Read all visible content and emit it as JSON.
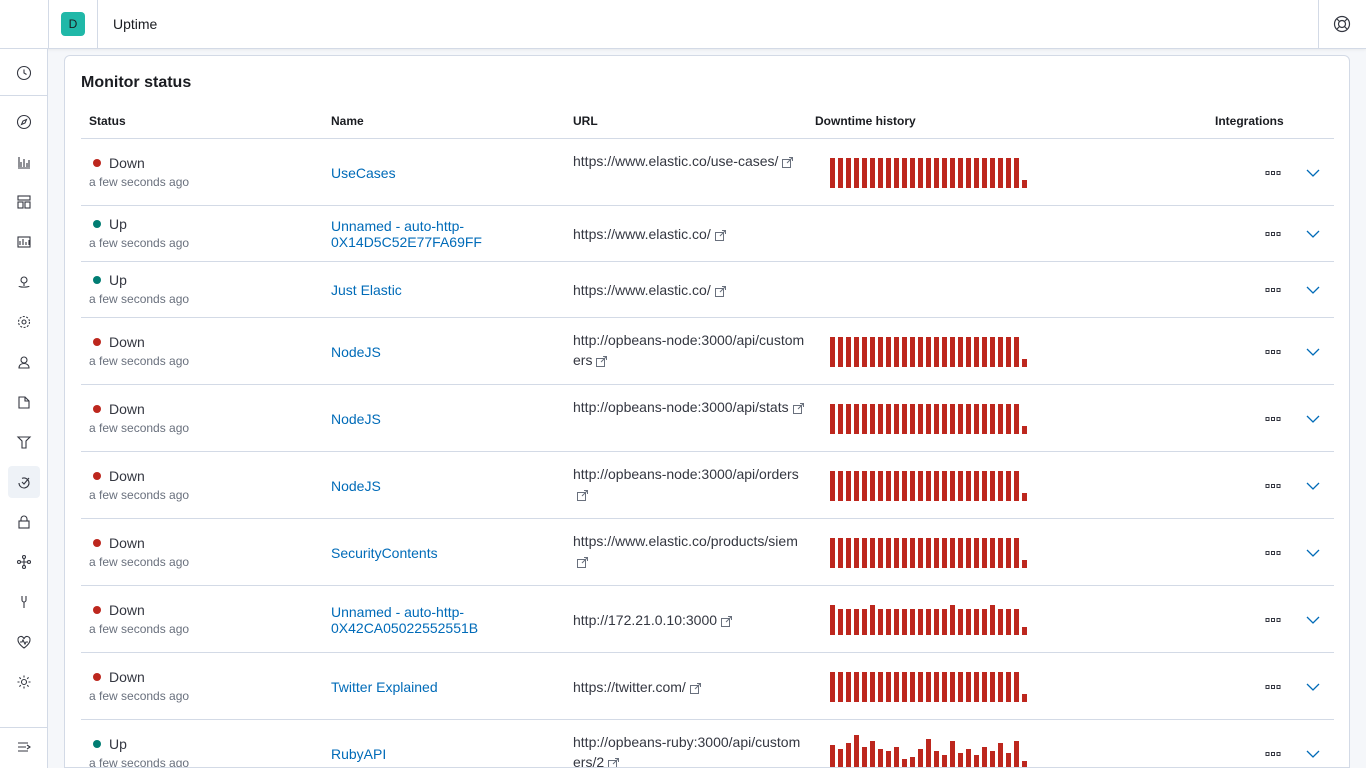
{
  "app": {
    "space_letter": "D",
    "title": "Uptime"
  },
  "sidebar": {
    "items": [
      {
        "icon": "clock-icon"
      },
      {
        "icon": "compass-icon"
      },
      {
        "icon": "chart-icon"
      },
      {
        "icon": "dashboard-icon"
      },
      {
        "icon": "canvas-icon"
      },
      {
        "icon": "maps-icon"
      },
      {
        "icon": "ml-icon"
      },
      {
        "icon": "user-icon"
      },
      {
        "icon": "logs-icon"
      },
      {
        "icon": "apm-icon"
      },
      {
        "icon": "uptime-icon"
      },
      {
        "icon": "lock-icon"
      },
      {
        "icon": "graph-icon"
      },
      {
        "icon": "wrench-icon"
      },
      {
        "icon": "heartbeat-icon"
      },
      {
        "icon": "gear-icon"
      }
    ],
    "collapse_icon": "dock-collapse-icon"
  },
  "panel": {
    "title": "Monitor status"
  },
  "table": {
    "headers": {
      "status": "Status",
      "name": "Name",
      "url": "URL",
      "history": "Downtime history",
      "integrations": "Integrations"
    },
    "rows": [
      {
        "status": "Down",
        "time": "a few seconds ago",
        "name": "UseCases",
        "url": "https://www.elastic.co/use-cases/",
        "history": "A"
      },
      {
        "status": "Up",
        "time": "a few seconds ago",
        "name": "Unnamed - auto-http-0X14D5C52E77FA69FF",
        "url": "https://www.elastic.co/",
        "history": ""
      },
      {
        "status": "Up",
        "time": "a few seconds ago",
        "name": "Just Elastic",
        "url": "https://www.elastic.co/",
        "history": ""
      },
      {
        "status": "Down",
        "time": "a few seconds ago",
        "name": "NodeJS",
        "url": "http://opbeans-node:3000/api/customers",
        "history": "A"
      },
      {
        "status": "Down",
        "time": "a few seconds ago",
        "name": "NodeJS",
        "url": "http://opbeans-node:3000/api/stats",
        "history": "A"
      },
      {
        "status": "Down",
        "time": "a few seconds ago",
        "name": "NodeJS",
        "url": "http://opbeans-node:3000/api/orders",
        "history": "A"
      },
      {
        "status": "Down",
        "time": "a few seconds ago",
        "name": "SecurityContents",
        "url": "https://www.elastic.co/products/siem",
        "history": "A"
      },
      {
        "status": "Down",
        "time": "a few seconds ago",
        "name": "Unnamed - auto-http-0X42CA05022552551B",
        "url": "http://172.21.0.10:3000",
        "history": "B"
      },
      {
        "status": "Down",
        "time": "a few seconds ago",
        "name": "Twitter Explained",
        "url": "https://twitter.com/",
        "history": "A"
      },
      {
        "status": "Up",
        "time": "a few seconds ago",
        "name": "RubyAPI",
        "url": "http://opbeans-ruby:3000/api/customers/2",
        "history": "C"
      }
    ]
  },
  "colors": {
    "down": "#bd271e",
    "up": "#017d73",
    "link": "#006bb8",
    "accent": "#20b8a8"
  }
}
